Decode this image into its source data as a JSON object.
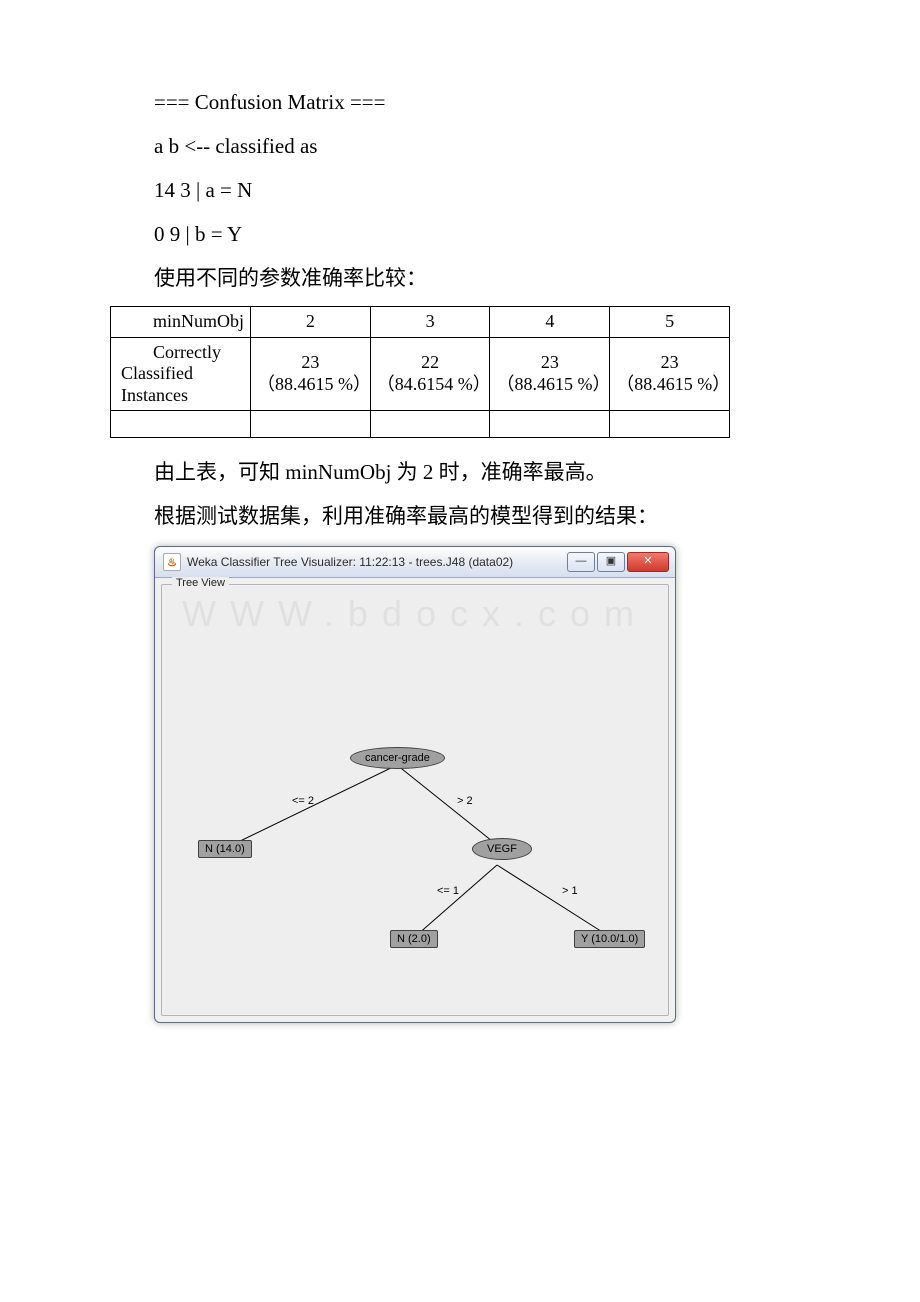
{
  "text": {
    "line1": "=== Confusion Matrix ===",
    "line2": " a b <-- classified as",
    "line3": " 14 3 | a = N",
    "line4": " 0 9 | b = Y",
    "line5": "使用不同的参数准确率比较：",
    "line6": "由上表，可知 minNumObj 为 2 时，准确率最高。",
    "line7": "根据测试数据集，利用准确率最高的模型得到的结果："
  },
  "table": {
    "header": {
      "c0": "minNumObj",
      "c1": "2",
      "c2": "3",
      "c3": "4",
      "c4": "5"
    },
    "rowLabel": "Correctly Classified Instances",
    "cells": {
      "v1_top": "23",
      "v1_bot": "（88.4615 %）",
      "v2_top": "22",
      "v2_bot": "（84.6154 %）",
      "v3_top": "23",
      "v3_bot": "（88.4615 %）",
      "v4_top": "23",
      "v4_bot": "（88.4615 %）"
    }
  },
  "window": {
    "icon_glyph": "♨",
    "title": "Weka Classifier Tree Visualizer: 11:22:13 - trees.J48 (data02)",
    "panel_label": "Tree View",
    "buttons": {
      "min": "—",
      "max": "▣",
      "close": "✕"
    },
    "watermark": "WWW.bdocx.com"
  },
  "tree": {
    "root": "cancer-grade",
    "edge_root_left": "<= 2",
    "edge_root_right": "> 2",
    "leaf_left": "N (14.0)",
    "node_right": "VEGF",
    "edge_v_left": "<= 1",
    "edge_v_right": "> 1",
    "leaf_v_left": "N (2.0)",
    "leaf_v_right": "Y (10.0/1.0)"
  },
  "chart_data": {
    "type": "table",
    "title": "使用不同的参数准确率比较",
    "categories": [
      "2",
      "3",
      "4",
      "5"
    ],
    "series": [
      {
        "name": "Correctly Classified Instances (count)",
        "values": [
          23,
          22,
          23,
          23
        ]
      },
      {
        "name": "Correctly Classified Instances (%)",
        "values": [
          88.4615,
          84.6154,
          88.4615,
          88.4615
        ]
      }
    ],
    "xlabel": "minNumObj",
    "ylabel": "Correctly Classified Instances"
  }
}
